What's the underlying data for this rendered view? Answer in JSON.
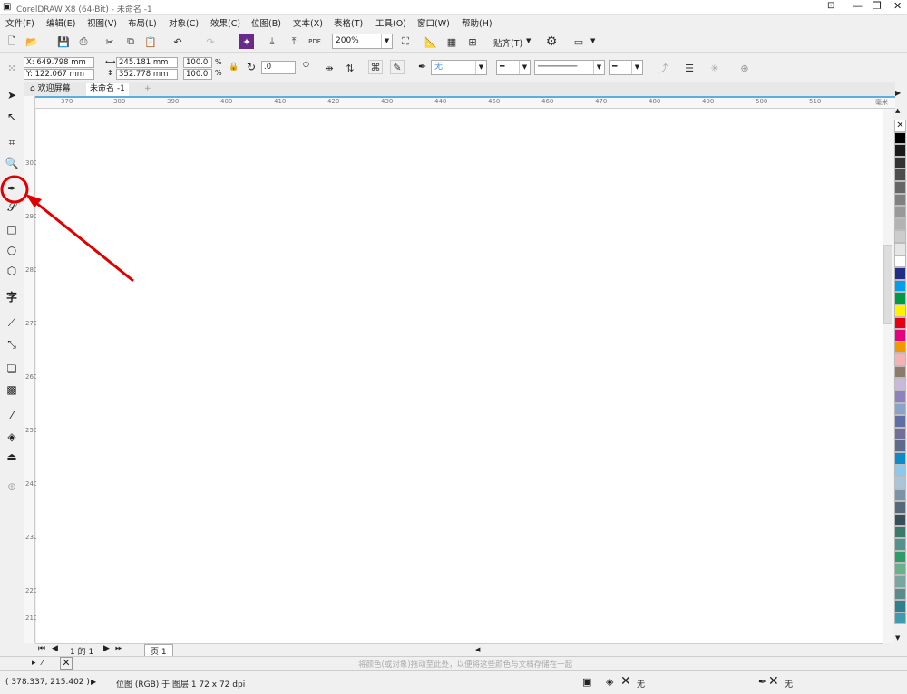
{
  "window": {
    "title": "CorelDRAW X8 (64-Bit) - 未命名 -1"
  },
  "menus": [
    "文件(F)",
    "编辑(E)",
    "视图(V)",
    "布局(L)",
    "对象(C)",
    "效果(C)",
    "位图(B)",
    "文本(X)",
    "表格(T)",
    "工具(O)",
    "窗口(W)",
    "帮助(H)"
  ],
  "toolbar": {
    "zoom": "200%",
    "snap_label": "贴齐(T)",
    "pdf": "PDF"
  },
  "props": {
    "x": "X: 649.798 mm",
    "y": "Y: 122.067 mm",
    "w": "245.181 mm",
    "h": "352.778 mm",
    "sx": "100.0",
    "sy": "100.0",
    "pct": "%",
    "angle": ".0",
    "fill": "无"
  },
  "tabs": {
    "welcome": "欢迎屏幕",
    "doc": "未命名 -1"
  },
  "hruler": [
    "370",
    "380",
    "390",
    "400",
    "410",
    "420",
    "430",
    "440",
    "450",
    "460",
    "470",
    "480",
    "490",
    "500",
    "510",
    "毫米"
  ],
  "vruler": [
    "300",
    "290",
    "280",
    "270",
    "260",
    "250",
    "240",
    "230",
    "220",
    "210"
  ],
  "pagebar": {
    "pos": "1 的 1",
    "page": "页 1"
  },
  "hint": "将颜色(或对象)拖动至此处，以便将这些颜色与文档存储在一起",
  "status": {
    "coords": "( 378.337, 215.402 )",
    "info": "位图 (RGB) 于 图层 1 72 x 72 dpi",
    "fill": "无",
    "outline": "无"
  },
  "colors": {
    "accent": "#5aaee0",
    "annotation": "#e00000"
  },
  "palette": [
    "#000000",
    "#1a1a1a",
    "#333333",
    "#4d4d4d",
    "#666666",
    "#808080",
    "#999999",
    "#b3b3b3",
    "#cccccc",
    "#e6e6e6",
    "#ffffff",
    "#1f2d86",
    "#00a0e9",
    "#009944",
    "#fff100",
    "#e60012",
    "#e4007f",
    "#f39800",
    "#f5b2b2",
    "#8c7b6b",
    "#c9b8d9",
    "#8f82bc",
    "#8aa3c8",
    "#5f6fa6",
    "#716f98",
    "#5d6a8a",
    "#0f8ac9",
    "#8cc8ea",
    "#a9c6d9",
    "#7b93a7",
    "#55697a",
    "#3a4d5a",
    "#3a7a6a",
    "#52928a",
    "#2f9b6a",
    "#6ab08a",
    "#78a6a0",
    "#5c8c8a",
    "#2f7f8f",
    "#3e9bb0"
  ]
}
